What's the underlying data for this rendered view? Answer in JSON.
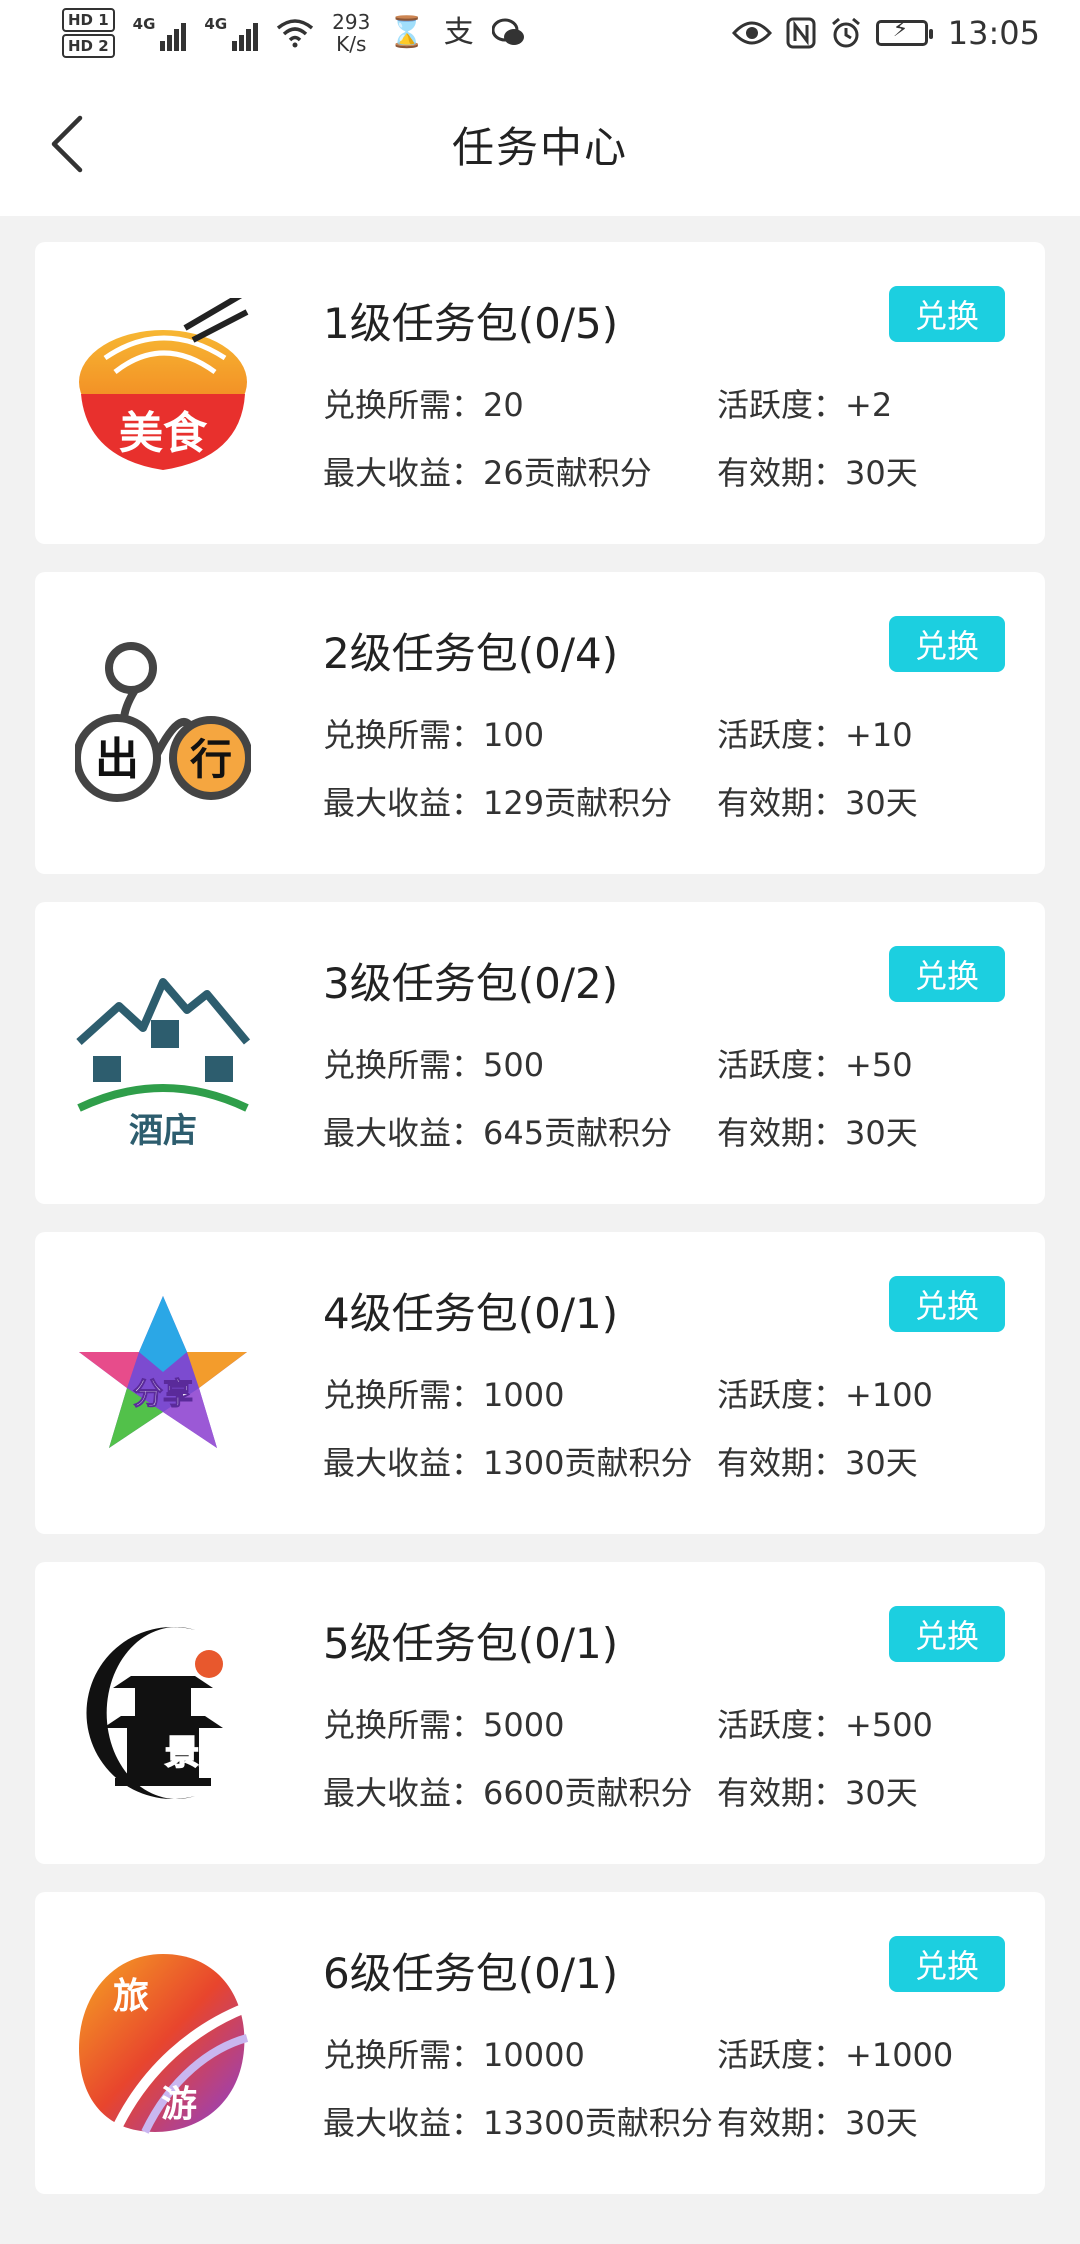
{
  "status_bar": {
    "hd1": "HD 1",
    "hd2": "HD 2",
    "net1": "4G",
    "net2": "4G",
    "speed_value": "293",
    "speed_unit": "K/s",
    "time": "13:05"
  },
  "header": {
    "title": "任务中心"
  },
  "labels": {
    "exchange_button": "兑换",
    "cost_label": "兑换所需：",
    "activity_label": "活跃度：",
    "max_income_label": "最大收益：",
    "validity_label": "有效期："
  },
  "tasks": [
    {
      "title": "1级任务包(0/5)",
      "cost": "20",
      "activity": "+2",
      "max_income": "26贡献积分",
      "validity": "30天",
      "logo_text": "美食",
      "logo_icon": "noodle-bowl-icon"
    },
    {
      "title": "2级任务包(0/4)",
      "cost": "100",
      "activity": "+10",
      "max_income": "129贡献积分",
      "validity": "30天",
      "logo_text_a": "出",
      "logo_text_b": "行",
      "logo_icon": "bicycle-icon"
    },
    {
      "title": "3级任务包(0/2)",
      "cost": "500",
      "activity": "+50",
      "max_income": "645贡献积分",
      "validity": "30天",
      "logo_text": "酒店",
      "logo_icon": "hotel-icon"
    },
    {
      "title": "4级任务包(0/1)",
      "cost": "1000",
      "activity": "+100",
      "max_income": "1300贡献积分",
      "validity": "30天",
      "logo_text": "分享",
      "logo_icon": "share-star-icon"
    },
    {
      "title": "5级任务包(0/1)",
      "cost": "5000",
      "activity": "+500",
      "max_income": "6600贡献积分",
      "validity": "30天",
      "logo_text": "景点",
      "logo_icon": "pagoda-icon"
    },
    {
      "title": "6级任务包(0/1)",
      "cost": "10000",
      "activity": "+1000",
      "max_income": "13300贡献积分",
      "validity": "30天",
      "logo_text_a": "旅",
      "logo_text_b": "游",
      "logo_icon": "travel-swirl-icon"
    }
  ],
  "colors": {
    "accent": "#1ccfe0",
    "background": "#f2f2f2",
    "card": "#ffffff"
  }
}
